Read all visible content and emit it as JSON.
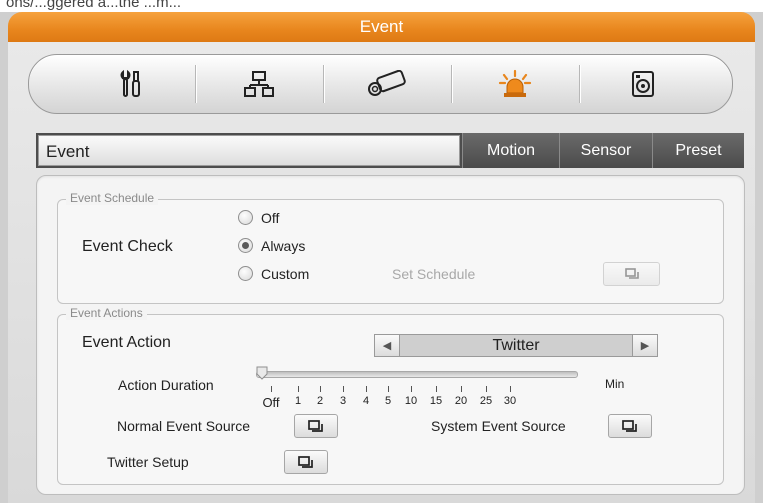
{
  "title": "Event",
  "top_cut_text": "ons/...ggered a...the ...m...",
  "toolbar": {
    "items": [
      {
        "icon": "tools-icon"
      },
      {
        "icon": "network-icon"
      },
      {
        "icon": "camera-icon"
      },
      {
        "icon": "alarm-light-icon"
      },
      {
        "icon": "storage-icon"
      }
    ]
  },
  "tabs": {
    "header": "Event",
    "items": [
      "Motion",
      "Sensor",
      "Preset"
    ]
  },
  "event_schedule": {
    "legend": "Event Schedule",
    "label": "Event Check",
    "options": [
      "Off",
      "Always",
      "Custom"
    ],
    "selected": "Always",
    "set_schedule_label": "Set Schedule"
  },
  "event_actions": {
    "legend": "Event Actions",
    "action_label": "Event Action",
    "action_value": "Twitter",
    "duration_label": "Action Duration",
    "duration_ticks": [
      "Off",
      "1",
      "2",
      "3",
      "4",
      "5",
      "10",
      "15",
      "20",
      "25",
      "30"
    ],
    "duration_unit": "Min",
    "duration_value": "Off",
    "normal_source_label": "Normal Event Source",
    "system_source_label": "System Event Source",
    "twitter_setup_label": "Twitter Setup"
  },
  "colors": {
    "title_bar": "#e8861d",
    "tab_background": "#4d4d4d",
    "alarm_icon": "#e8861d"
  }
}
